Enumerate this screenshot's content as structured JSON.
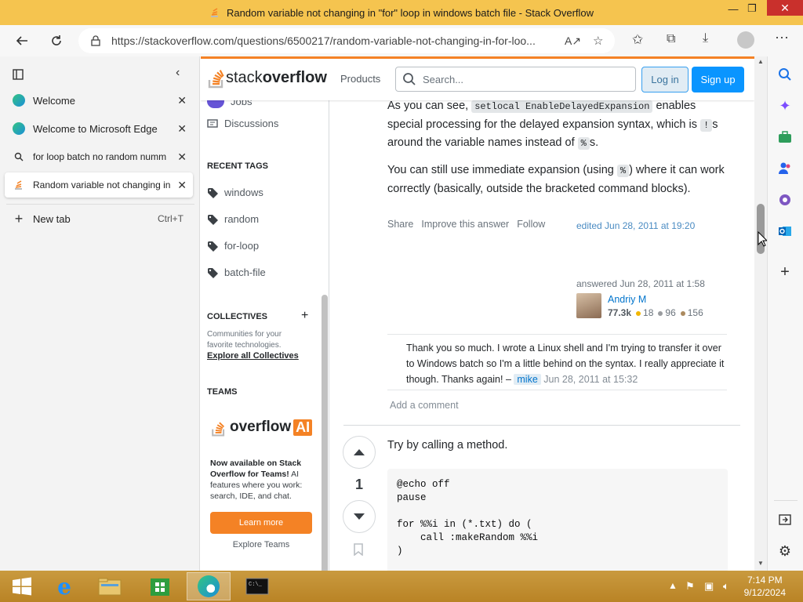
{
  "window": {
    "title": "Random variable not changing in \"for\" loop in windows batch file - Stack Overflow",
    "min": "—",
    "max": "❐",
    "close": "✕"
  },
  "browser": {
    "url": "https://stackoverflow.com/questions/6500217/random-variable-not-changing-in-for-loo..."
  },
  "tabs": {
    "items": [
      {
        "label": "Welcome",
        "icon": "edge-icon"
      },
      {
        "label": "Welcome to Microsoft Edge",
        "icon": "edge-icon"
      },
      {
        "label": "for loop batch no random numm",
        "icon": "search-icon"
      },
      {
        "label": "Random variable not changing in",
        "icon": "stackoverflow-icon"
      }
    ],
    "new_tab": "New tab",
    "new_tab_shortcut": "Ctrl+T"
  },
  "so_header": {
    "logo_word1": "stack",
    "logo_word2": "overflow",
    "products": "Products",
    "search_placeholder": "Search...",
    "login": "Log in",
    "signup": "Sign up"
  },
  "left_nav": {
    "jobs": "Jobs",
    "discussions": "Discussions",
    "recent_tags_heading": "RECENT TAGS",
    "tags": [
      "windows",
      "random",
      "for-loop",
      "batch-file"
    ],
    "collectives_heading": "COLLECTIVES",
    "collectives_desc": "Communities for your favorite technologies.",
    "collectives_link": "Explore all Collectives",
    "teams_heading": "TEAMS",
    "ai_word1": "overflow",
    "ai_word2": "AI",
    "ai_desc_bold": "Now available on Stack Overflow for Teams!",
    "ai_desc": " AI features where you work: search, IDE, and chat.",
    "learn_more": "Learn more",
    "explore_teams": "Explore Teams"
  },
  "answer": {
    "p1_a": "As you can see, ",
    "p1_code": "setlocal EnableDelayedExpansion",
    "p1_b": " enables special processing for the delayed expansion syntax, which is ",
    "p1_code2": "!",
    "p1_c": "s around the variable names instead of ",
    "p1_code3": "%",
    "p1_d": "s.",
    "p2_a": "You can still use immediate expansion (using ",
    "p2_code": "%",
    "p2_b": ") where it can work correctly (basically, outside the bracketed command blocks).",
    "share": "Share",
    "improve": "Improve this answer",
    "follow": "Follow",
    "edited": "edited Jun 28, 2011 at 19:20",
    "answered": "answered Jun 28, 2011 at 1:58",
    "user": "Andriy M",
    "rep": "77.3k",
    "gold": "18",
    "silver": "96",
    "bronze": "156",
    "comment_text": "Thank you so much. I wrote a Linux shell and I'm trying to transfer it over to Windows batch so I'm a little behind on the syntax. I really appreciate it though. Thanks again! –",
    "comment_user": "mike",
    "comment_date": "Jun 28, 2011 at 15:32",
    "add_comment": "Add a comment"
  },
  "answer2": {
    "vote_count": "1",
    "text": "Try by calling a method.",
    "code": "@echo off\npause\n\nfor %%i in (*.txt) do (\n    call :makeRandom %%i\n)"
  },
  "taskbar": {
    "time": "7:14 PM",
    "date": "9/12/2024"
  },
  "colors": {
    "so_orange": "#f48225",
    "so_blue": "#0a95ff",
    "title_bar": "#f5c44f",
    "taskbar": "#c99a3f"
  }
}
